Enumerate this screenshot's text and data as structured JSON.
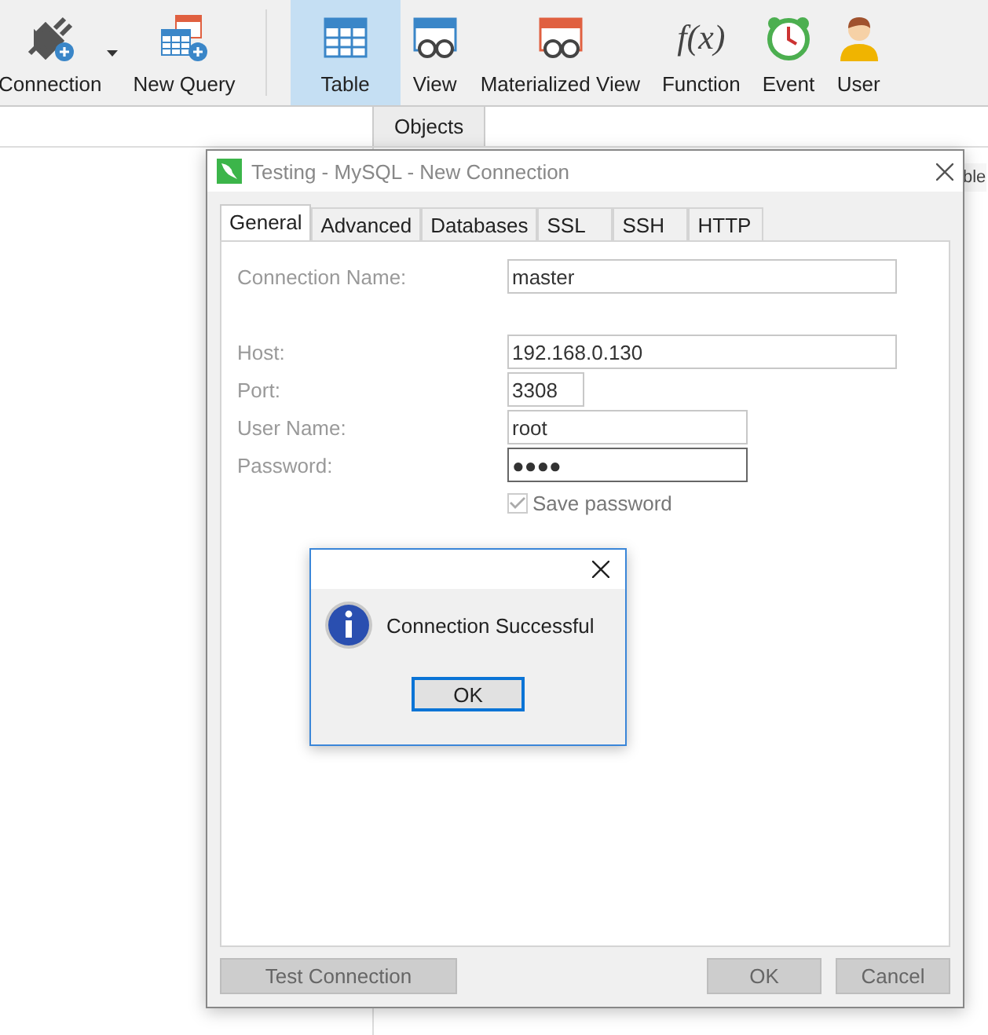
{
  "toolbar": {
    "items": [
      {
        "kind": "connection",
        "label": "Connection",
        "selected": false,
        "dropdown": true
      },
      {
        "kind": "new_query",
        "label": "New Query",
        "selected": false,
        "dropdown": false
      },
      {
        "kind": "table",
        "label": "Table",
        "selected": true,
        "dropdown": false
      },
      {
        "kind": "view",
        "label": "View",
        "selected": false,
        "dropdown": false
      },
      {
        "kind": "materialized_view",
        "label": "Materialized View",
        "selected": false,
        "dropdown": false
      },
      {
        "kind": "function",
        "label": "Function",
        "glyph": "f(x)",
        "selected": false,
        "dropdown": false
      },
      {
        "kind": "event",
        "label": "Event",
        "selected": false,
        "dropdown": false
      },
      {
        "kind": "user",
        "label": "User",
        "selected": false,
        "dropdown": false
      }
    ]
  },
  "main_tabs": [
    {
      "label": "Objects",
      "selected": true
    },
    {
      "label": "ble",
      "selected": false
    }
  ],
  "dialog": {
    "title": "Testing - MySQL - New Connection",
    "tabs": [
      {
        "label": "General",
        "selected": true
      },
      {
        "label": "Advanced",
        "selected": false
      },
      {
        "label": "Databases",
        "selected": false
      },
      {
        "label": "SSL",
        "selected": false
      },
      {
        "label": "SSH",
        "selected": false
      },
      {
        "label": "HTTP",
        "selected": false
      }
    ],
    "fields": [
      {
        "label": "Connection Name:",
        "value": "master",
        "kind": "long",
        "focused": false
      },
      {
        "label": "Host:",
        "value": "192.168.0.130",
        "kind": "long",
        "focused": false
      },
      {
        "label": "Port:",
        "value": "3308",
        "kind": "short",
        "focused": false
      },
      {
        "label": "User Name:",
        "value": "root",
        "kind": "medium",
        "focused": false
      },
      {
        "label": "Password:",
        "value": "●●●●",
        "kind": "medium",
        "focused": true
      }
    ],
    "save_password": {
      "label": "Save password",
      "checked": true,
      "disabled": true
    },
    "buttons": [
      {
        "label": "Test Connection",
        "kind": "left"
      },
      {
        "label": "OK",
        "kind": "right"
      },
      {
        "label": "Cancel",
        "kind": "right"
      }
    ]
  },
  "message_box": {
    "message": "Connection Successful",
    "button": "OK"
  }
}
